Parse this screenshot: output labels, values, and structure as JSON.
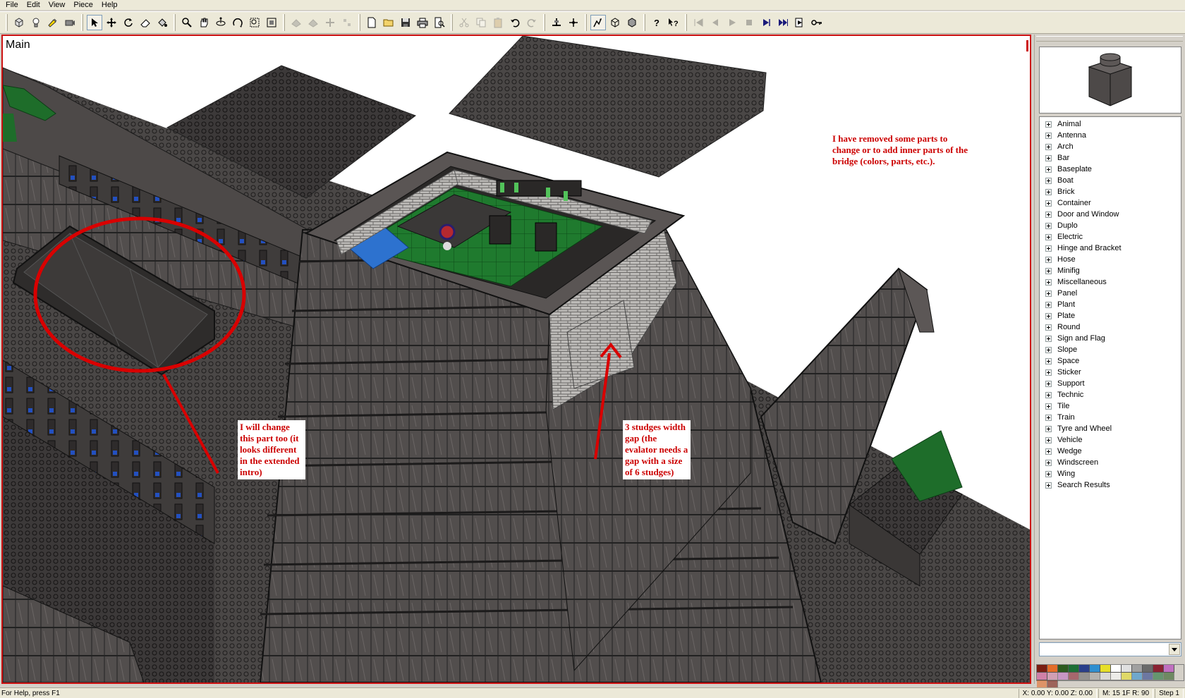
{
  "menu": [
    "File",
    "Edit",
    "View",
    "Piece",
    "Help"
  ],
  "toolbar_icons": [
    "new-piece-icon",
    "lightbulb-icon",
    "paint-icon",
    "camera-icon",
    "select-arrow-icon",
    "move-icon",
    "rotate-icon",
    "eraser-icon",
    "paint-bucket-icon",
    "zoom-icon",
    "pan-icon",
    "rotate-view-icon",
    "roll-icon",
    "zoom-region-icon",
    "zoom-extents-icon",
    "prev-step-disabled-icon",
    "next-step-disabled-icon",
    "snap-a-icon",
    "snap-b-icon",
    "new-file-icon",
    "open-folder-icon",
    "save-icon",
    "print-icon",
    "print-preview-icon",
    "cut-icon",
    "copy-icon",
    "paste-icon",
    "undo-icon",
    "redo-icon",
    "snap-move-icon",
    "snap-angle-icon",
    "fast-render-icon",
    "wire-icon",
    "solid-icon",
    "help-icon",
    "context-help-icon",
    "first-step-icon",
    "prev-step-icon",
    "play-icon",
    "stop-icon",
    "next-step-icon",
    "last-step-icon",
    "add-step-icon",
    "key-icon"
  ],
  "viewport": {
    "title": "Main",
    "annotations": {
      "removed_parts": "I have removed some parts to change or to add inner parts of the bridge (colors, parts, etc.).",
      "change_part": "I will change this part too (it looks different in the extended intro)",
      "gap": "3 studges width gap (the evalator needs a gap with a size of 6 studges)"
    }
  },
  "piece_tree": [
    "Animal",
    "Antenna",
    "Arch",
    "Bar",
    "Baseplate",
    "Boat",
    "Brick",
    "Container",
    "Door and Window",
    "Duplo",
    "Electric",
    "Hinge and Bracket",
    "Hose",
    "Minifig",
    "Miscellaneous",
    "Panel",
    "Plant",
    "Plate",
    "Round",
    "Sign and Flag",
    "Slope",
    "Space",
    "Sticker",
    "Support",
    "Technic",
    "Tile",
    "Train",
    "Tyre and Wheel",
    "Vehicle",
    "Wedge",
    "Windscreen",
    "Wing",
    "Search Results"
  ],
  "palette": [
    "#7a1e12",
    "#e36d2a",
    "#2d5a1f",
    "#1e6f35",
    "#2a3f8a",
    "#2f8fd0",
    "#e7df2a",
    "#ffffff",
    "#e0e0e0",
    "#a0a0a0",
    "#6a6a6a",
    "#8a2232",
    "#c070c0",
    "#d080a8"
  ],
  "status": {
    "help": "For Help, press F1",
    "coords": "X: 0.00 Y: 0.00 Z: 0.00",
    "mode": "M: 15 1F R: 90",
    "step": "Step 1"
  }
}
